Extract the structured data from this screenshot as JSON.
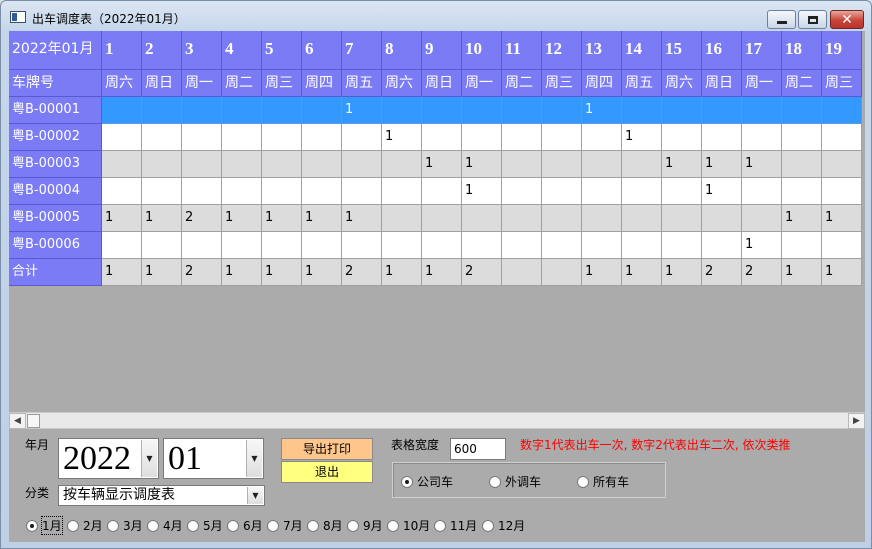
{
  "window": {
    "title": "出车调度表（2022年01月）",
    "minimize_icon": "minimize-icon",
    "maximize_icon": "maximize-icon",
    "close_icon": "close-icon"
  },
  "grid": {
    "corner_label": "2022年01月",
    "row_header_label": "车牌号",
    "days": [
      "1",
      "2",
      "3",
      "4",
      "5",
      "6",
      "7",
      "8",
      "9",
      "10",
      "11",
      "12",
      "13",
      "14",
      "15",
      "16",
      "17",
      "18",
      "19"
    ],
    "weekdays": [
      "周六",
      "周日",
      "周一",
      "周二",
      "周三",
      "周四",
      "周五",
      "周六",
      "周日",
      "周一",
      "周二",
      "周三",
      "周四",
      "周五",
      "周六",
      "周日",
      "周一",
      "周二",
      "周三"
    ],
    "rows": [
      {
        "plate": "粤B-00001",
        "values": [
          "",
          "",
          "",
          "",
          "",
          "",
          "1",
          "",
          "",
          "",
          "",
          "",
          "1",
          "",
          "",
          "",
          "",
          "",
          ""
        ]
      },
      {
        "plate": "粤B-00002",
        "values": [
          "",
          "",
          "",
          "",
          "",
          "",
          "",
          "1",
          "",
          "",
          "",
          "",
          "",
          "1",
          "",
          "",
          "",
          "",
          ""
        ]
      },
      {
        "plate": "粤B-00003",
        "values": [
          "",
          "",
          "",
          "",
          "",
          "",
          "",
          "",
          "1",
          "1",
          "",
          "",
          "",
          "",
          "1",
          "1",
          "1",
          "",
          ""
        ]
      },
      {
        "plate": "粤B-00004",
        "values": [
          "",
          "",
          "",
          "",
          "",
          "",
          "",
          "",
          "",
          "1",
          "",
          "",
          "",
          "",
          "",
          "1",
          "",
          "",
          ""
        ]
      },
      {
        "plate": "粤B-00005",
        "values": [
          "1",
          "1",
          "2",
          "1",
          "1",
          "1",
          "1",
          "",
          "",
          "",
          "",
          "",
          "",
          "",
          "",
          "",
          "",
          "1",
          "1"
        ]
      },
      {
        "plate": "粤B-00006",
        "values": [
          "",
          "",
          "",
          "",
          "",
          "",
          "",
          "",
          "",
          "",
          "",
          "",
          "",
          "",
          "",
          "",
          "1",
          "",
          ""
        ]
      }
    ],
    "total": {
      "plate": "合计",
      "values": [
        "1",
        "1",
        "2",
        "1",
        "1",
        "1",
        "2",
        "1",
        "1",
        "2",
        "",
        "",
        "1",
        "1",
        "1",
        "2",
        "2",
        "1",
        "1"
      ]
    },
    "selected_row": 0
  },
  "controls": {
    "year_label": "年月",
    "year_value": "2022",
    "month_value": "01",
    "category_label": "分类",
    "category_value": "按车辆显示调度表",
    "export_button": "导出打印",
    "exit_button": "退出",
    "width_label": "表格宽度",
    "width_value": "600",
    "hint": "数字1代表出车一次, 数字2代表出车二次, 依次类推",
    "vehicle_filters": [
      {
        "label": "公司车",
        "checked": true
      },
      {
        "label": "外调车",
        "checked": false
      },
      {
        "label": "所有车",
        "checked": false
      }
    ],
    "months": [
      {
        "label": "1月",
        "checked": true
      },
      {
        "label": "2月",
        "checked": false
      },
      {
        "label": "3月",
        "checked": false
      },
      {
        "label": "4月",
        "checked": false
      },
      {
        "label": "5月",
        "checked": false
      },
      {
        "label": "6月",
        "checked": false
      },
      {
        "label": "7月",
        "checked": false
      },
      {
        "label": "8月",
        "checked": false
      },
      {
        "label": "9月",
        "checked": false
      },
      {
        "label": "10月",
        "checked": false
      },
      {
        "label": "11月",
        "checked": false
      },
      {
        "label": "12月",
        "checked": false
      }
    ]
  },
  "colors": {
    "header_bg": "#7b7bf6",
    "selected_row_bg": "#3399ff",
    "odd_row_bg": "#ffffff",
    "even_row_bg": "#dcdcdc",
    "empty_area_bg": "#ababab",
    "hint_color": "#ff0000",
    "export_button_bg": "#ffc68c",
    "exit_button_bg": "#ffff80"
  }
}
